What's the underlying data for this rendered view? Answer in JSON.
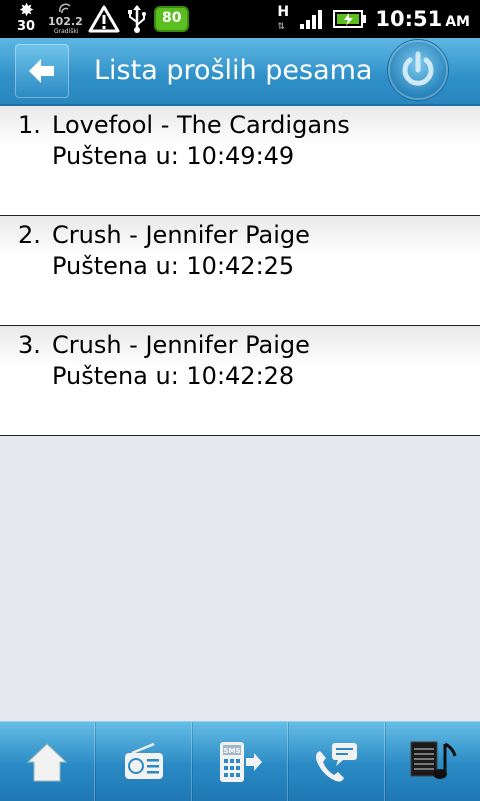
{
  "status_bar": {
    "weather_temp": "30",
    "radio_frequency": "102.2",
    "radio_city": "Gradiški",
    "battery_level": "80",
    "network": "H",
    "time": "10:51",
    "ampm": "AM"
  },
  "header": {
    "title": "Lista prošlih pesama"
  },
  "songs": [
    {
      "index": "1.",
      "title": "Lovefool - The Cardigans",
      "played": "Puštena u: 10:49:49"
    },
    {
      "index": "2.",
      "title": "Crush - Jennifer Paige",
      "played": "Puštena u: 10:42:25"
    },
    {
      "index": "3.",
      "title": "Crush - Jennifer Paige",
      "played": "Puštena u: 10:42:28"
    }
  ],
  "bottom_tabs": [
    {
      "icon": "home-icon"
    },
    {
      "icon": "radio-icon"
    },
    {
      "icon": "sms-icon",
      "label": "SMS"
    },
    {
      "icon": "call-chat-icon"
    },
    {
      "icon": "song-list-icon"
    }
  ],
  "colors": {
    "header": "#2f90c8",
    "battery": "#5bbf20",
    "background": "#e6e7ef"
  }
}
